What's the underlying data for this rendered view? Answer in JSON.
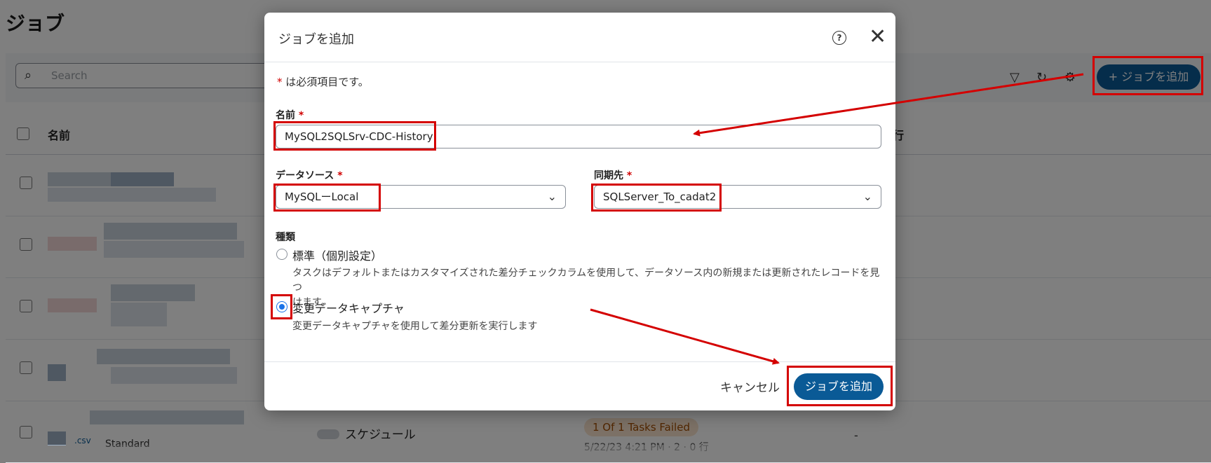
{
  "page": {
    "title": "ジョブ",
    "search_placeholder": "Search",
    "add_job_label": "+ ジョブを追加",
    "col_name": "名前",
    "col_exec": "行",
    "schedule_label": "スケジュール",
    "failed_badge": "1 Of 1 Tasks Failed",
    "dash": "-",
    "standard": "Standard",
    "csv": ".csv",
    "time_partial": "5/22/23 4:21 PM · 2 · 0 行"
  },
  "modal": {
    "title": "ジョブを追加",
    "required_note_star": "*",
    "required_note": " は必須項目です。",
    "name_label": "名前",
    "name_value": "MySQL2SQLSrv-CDC-History",
    "source_label": "データソース",
    "source_value": "MySQLーLocal",
    "dest_label": "同期先",
    "dest_value": "SQLServer_To_cadat2",
    "type_label": "種類",
    "option_standard_label": "標準（個別設定）",
    "option_standard_desc_1": "タスクはデフォルトまたはカスタマイズされた差分チェックカラムを使用して、データソース内の新規または更新されたレコードを見つ",
    "option_standard_desc_2": "けます。",
    "option_cdc_label": "変更データキャプチャ",
    "option_cdc_desc": "変更データキャプチャを使用して差分更新を実行します",
    "selected_option": "cdc",
    "cancel_label": "キャンセル",
    "submit_label": "ジョブを追加",
    "star": "*"
  },
  "colors": {
    "primary": "#0a5a96",
    "annotation": "#d40000",
    "radio_selected": "#1a73e8"
  }
}
